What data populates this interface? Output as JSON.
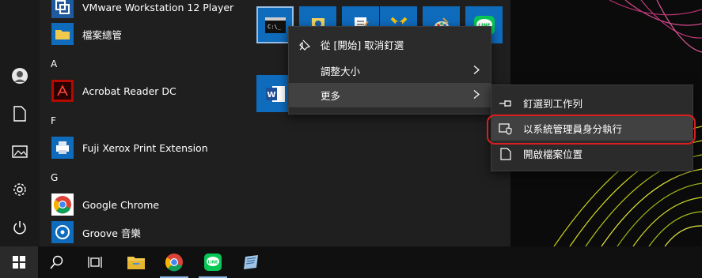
{
  "start_menu": {
    "apps": [
      {
        "label": "VMware Workstation 12 Player",
        "icon": "vmware-icon"
      },
      {
        "label": "檔案總管",
        "icon": "folder-icon"
      },
      {
        "label": "Acrobat Reader DC",
        "icon": "acrobat-icon"
      },
      {
        "label": "Fuji Xerox Print Extension",
        "icon": "printer-icon"
      },
      {
        "label": "Google Chrome",
        "icon": "chrome-icon"
      },
      {
        "label": "Groove 音樂",
        "icon": "groove-icon"
      }
    ],
    "letters": [
      "A",
      "F",
      "G"
    ],
    "rail_icons": [
      "user-avatar-icon",
      "document-icon",
      "pictures-icon",
      "settings-gear-icon",
      "power-icon"
    ]
  },
  "context_menu": {
    "items": [
      {
        "label": "從 [開始] 取消釘選",
        "icon": "unpin-icon"
      },
      {
        "label": "調整大小",
        "has_submenu": true
      },
      {
        "label": "更多",
        "has_submenu": true,
        "highlighted": true
      }
    ]
  },
  "submenu": {
    "items": [
      {
        "label": "釘選到工作列",
        "icon": "pin-taskbar-icon"
      },
      {
        "label": "以系統管理員身分執行",
        "icon": "run-as-admin-icon",
        "highlighted": true
      },
      {
        "label": "開啟檔案位置",
        "icon": "file-location-icon"
      }
    ]
  },
  "taskbar": {
    "icons": [
      "windows-start-icon",
      "search-icon",
      "task-view-icon",
      "file-explorer-icon",
      "chrome-icon",
      "line-icon",
      "notepad-icon"
    ]
  },
  "colors": {
    "accent": "#0f6cbd",
    "highlight_ring": "#d81e1e"
  }
}
